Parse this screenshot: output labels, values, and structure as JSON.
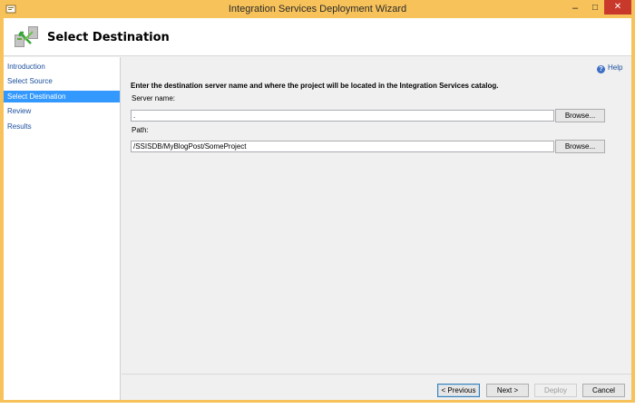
{
  "window": {
    "title": "Integration Services Deployment Wizard",
    "controls": {
      "minimize": "–",
      "maximize": "□",
      "close": "✕"
    }
  },
  "header": {
    "title": "Select Destination"
  },
  "sidebar": {
    "items": [
      {
        "label": "Introduction",
        "active": false
      },
      {
        "label": "Select Source",
        "active": false
      },
      {
        "label": "Select Destination",
        "active": true
      },
      {
        "label": "Review",
        "active": false
      },
      {
        "label": "Results",
        "active": false
      }
    ]
  },
  "main": {
    "help_label": "Help",
    "instruction": "Enter the destination server name and where the project will be located in the Integration Services catalog.",
    "server": {
      "label": "Server name:",
      "value": ".",
      "browse_label": "Browse..."
    },
    "path": {
      "label": "Path:",
      "value": "/SSISDB/MyBlogPost/SomeProject",
      "browse_label": "Browse..."
    }
  },
  "footer": {
    "previous_label": "< Previous",
    "next_label": "Next >",
    "deploy_label": "Deploy",
    "cancel_label": "Cancel"
  },
  "colors": {
    "title_bar": "#f7c25a",
    "close_button": "#c8392c",
    "selected_nav": "#3399ff",
    "link_text": "#1a4e9c"
  }
}
